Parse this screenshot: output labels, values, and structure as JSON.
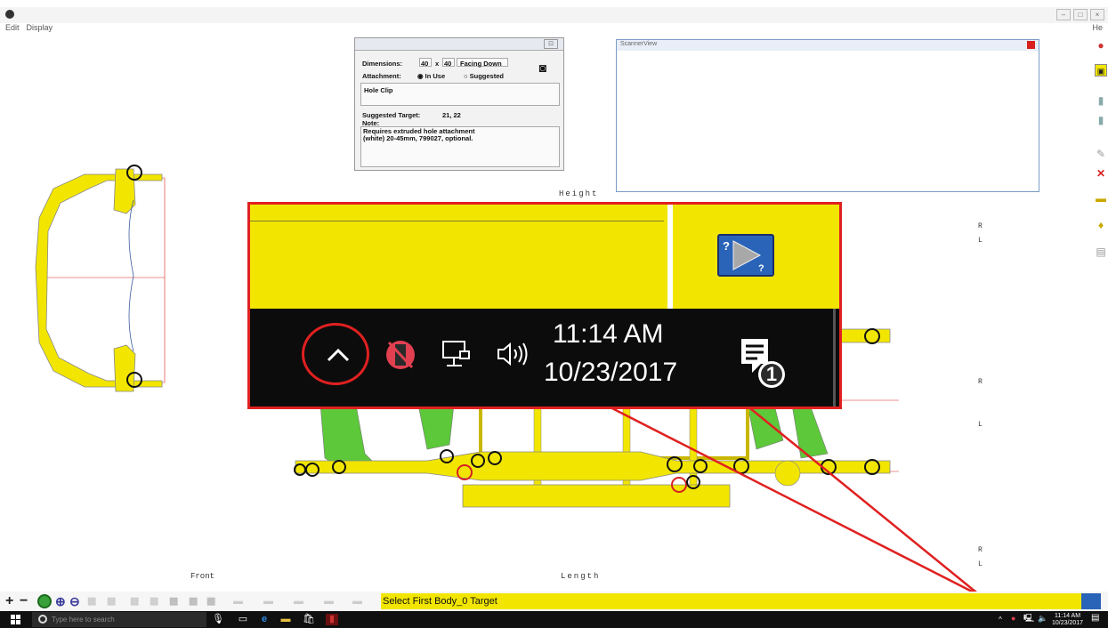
{
  "menu": {
    "edit": "Edit",
    "display": "Display",
    "help": "He"
  },
  "dialog": {
    "dimensions_label": "Dimensions:",
    "dim_w": "40",
    "dim_x": "x",
    "dim_h": "40",
    "facing": "Facing Down",
    "attachment_label": "Attachment:",
    "in_use": "In Use",
    "suggested": "Suggested",
    "item": "Hole Clip",
    "suggested_target_label": "Suggested Target:",
    "suggested_target_value": "21, 22",
    "note_label": "Note:",
    "note_text": "Requires extruded hole attachment (white) 20-45mm, 799027, optional."
  },
  "scanner": {
    "title": "ScannerView"
  },
  "axes": {
    "height": "Height",
    "length": "Length",
    "front": "Front"
  },
  "side_labels": {
    "r": "R",
    "l": "L"
  },
  "callout": {
    "time": "11:14 AM",
    "date": "10/23/2017",
    "notification_count": "1"
  },
  "toolbar": {
    "plus": "+",
    "minus": "−",
    "status_text": "Select First Body_0 Target"
  },
  "taskbar": {
    "search_placeholder": "Type here to search",
    "time": "11:14 AM",
    "date": "10/23/2017"
  },
  "colors": {
    "frame_yellow": "#f2e600",
    "frame_green": "#5cc83a",
    "callout_red": "#e02020",
    "selection_blue": "#2a64b8"
  }
}
